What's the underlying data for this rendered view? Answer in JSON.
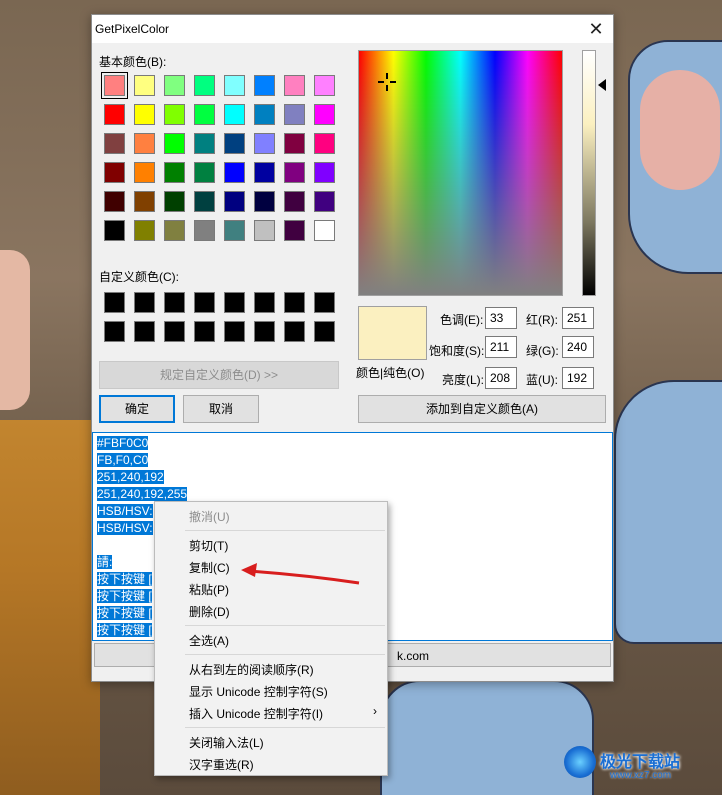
{
  "window": {
    "title": "GetPixelColor",
    "close_glyph": "✕"
  },
  "basic_colors": {
    "label": "基本颜色(B):",
    "rows": [
      [
        "#ff8080",
        "#ffff80",
        "#80ff80",
        "#00ff80",
        "#80ffff",
        "#0080ff",
        "#ff80c0",
        "#ff80ff"
      ],
      [
        "#ff0000",
        "#ffff00",
        "#80ff00",
        "#00ff40",
        "#00ffff",
        "#0080c0",
        "#8080c0",
        "#ff00ff"
      ],
      [
        "#804040",
        "#ff8040",
        "#00ff00",
        "#008080",
        "#004080",
        "#8080ff",
        "#800040",
        "#ff0080"
      ],
      [
        "#800000",
        "#ff8000",
        "#008000",
        "#008040",
        "#0000ff",
        "#0000a0",
        "#800080",
        "#8000ff"
      ],
      [
        "#400000",
        "#804000",
        "#004000",
        "#004040",
        "#000080",
        "#000040",
        "#400040",
        "#400080"
      ],
      [
        "#000000",
        "#808000",
        "#808040",
        "#808080",
        "#408080",
        "#c0c0c0",
        "#400040",
        "#ffffff"
      ]
    ]
  },
  "custom_colors": {
    "label": "自定义颜色(C):",
    "rows": [
      [
        "#000000",
        "#000000",
        "#000000",
        "#000000",
        "#000000",
        "#000000",
        "#000000",
        "#000000"
      ],
      [
        "#000000",
        "#000000",
        "#000000",
        "#000000",
        "#000000",
        "#000000",
        "#000000",
        "#000000"
      ]
    ]
  },
  "buttons": {
    "define_custom": "规定自定义颜色(D) >>",
    "ok": "确定",
    "cancel": "取消",
    "add_custom": "添加到自定义颜色(A)"
  },
  "color_values": {
    "preview_label": "颜色|纯色(O)",
    "preview_color": "#fbf0c0",
    "hue_label": "色调(E):",
    "hue": "33",
    "sat_label": "饱和度(S):",
    "sat": "211",
    "lum_label": "亮度(L):",
    "lum": "208",
    "red_label": "红(R):",
    "red": "251",
    "green_label": "绿(G):",
    "green": "240",
    "blue_label": "蓝(U):",
    "blue": "192"
  },
  "output_lines": [
    "#FBF0C0",
    "FB,F0,C0",
    "251,240,192",
    "251,240,192,255",
    "HSB/HSV:",
    "HSB/HSV:",
    "",
    "請:",
    "按下按键 [",
    "按下按键 [",
    "按下按键 [",
    "按下按键 ["
  ],
  "bottom_url": "k.com",
  "context_menu": {
    "undo": "撤消(U)",
    "cut": "剪切(T)",
    "copy": "复制(C)",
    "paste": "粘贴(P)",
    "delete": "删除(D)",
    "select_all": "全选(A)",
    "rtl": "从右到左的阅读顺序(R)",
    "show_unicode": "显示 Unicode 控制字符(S)",
    "insert_unicode": "插入 Unicode 控制字符(I)",
    "submenu_arrow": "›",
    "close_ime": "关闭输入法(L)",
    "reconvert": "汉字重选(R)"
  },
  "watermark": {
    "text": "极光下载站",
    "sub": "www.xz7.com"
  }
}
